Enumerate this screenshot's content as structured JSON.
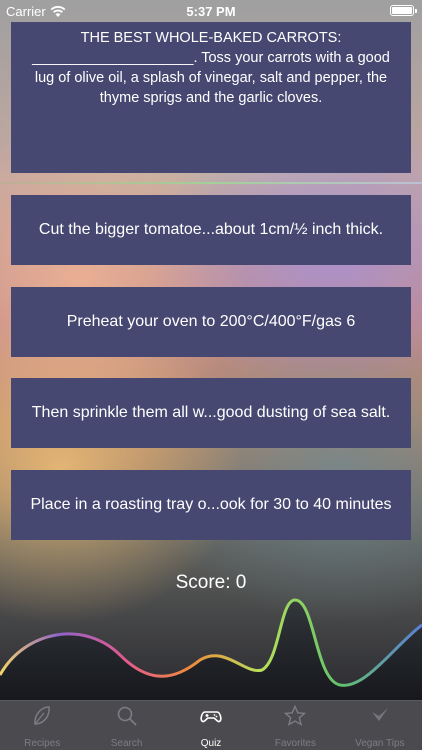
{
  "status": {
    "carrier": "Carrier",
    "time": "5:37 PM"
  },
  "question": {
    "title": "THE BEST WHOLE-BAKED CARROTS:",
    "text": "____________________. Toss your carrots with a good lug of olive oil, a splash of vinegar, salt and pepper, the thyme sprigs and the garlic cloves."
  },
  "answers": [
    "Cut the bigger tomatoe...about 1cm/½ inch thick.",
    "Preheat your oven to 200°C/400°F/gas 6",
    "Then sprinkle them all w...good dusting of sea salt.",
    "Place in a roasting tray o...ook for 30 to 40 minutes"
  ],
  "score": "Score: 0",
  "tabs": [
    {
      "label": "Recipes",
      "icon": "leaf-icon"
    },
    {
      "label": "Search",
      "icon": "search-icon"
    },
    {
      "label": "Quiz",
      "icon": "gamepad-icon",
      "active": true
    },
    {
      "label": "Favorites",
      "icon": "star-icon"
    },
    {
      "label": "Vegan Tips",
      "icon": "checkmark-icon"
    }
  ]
}
